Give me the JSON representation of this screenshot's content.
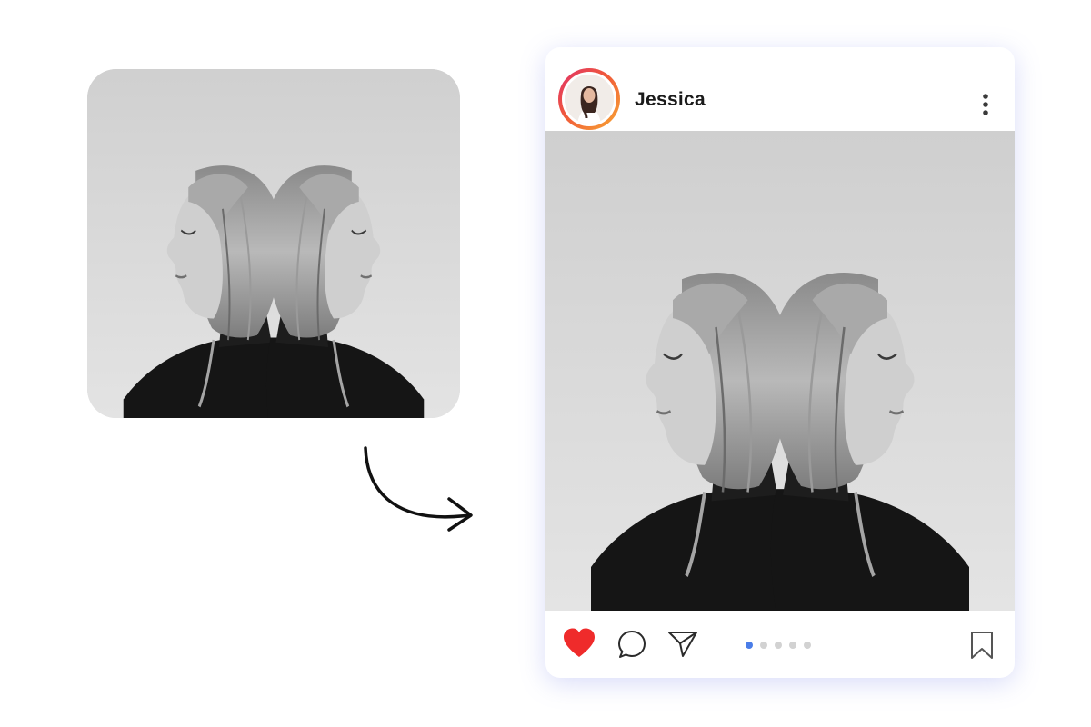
{
  "post": {
    "username": "Jessica",
    "avatar_icon": "profile-photo-icon",
    "menu_icon": "more-vertical-icon",
    "actions": {
      "like_icon": "heart-icon",
      "comment_icon": "comment-bubble-icon",
      "share_icon": "send-paper-plane-icon",
      "save_icon": "bookmark-icon",
      "liked": true
    },
    "carousel": {
      "total_slides": 5,
      "active_index": 0
    }
  },
  "colors": {
    "like": "#ef2b2b",
    "pager_active": "#4a7de8",
    "pager_inactive": "#d2d2d2",
    "avatar_ring_start": "#e0306a",
    "avatar_ring_end": "#f8a832",
    "card_shadow": "#7882eb"
  }
}
